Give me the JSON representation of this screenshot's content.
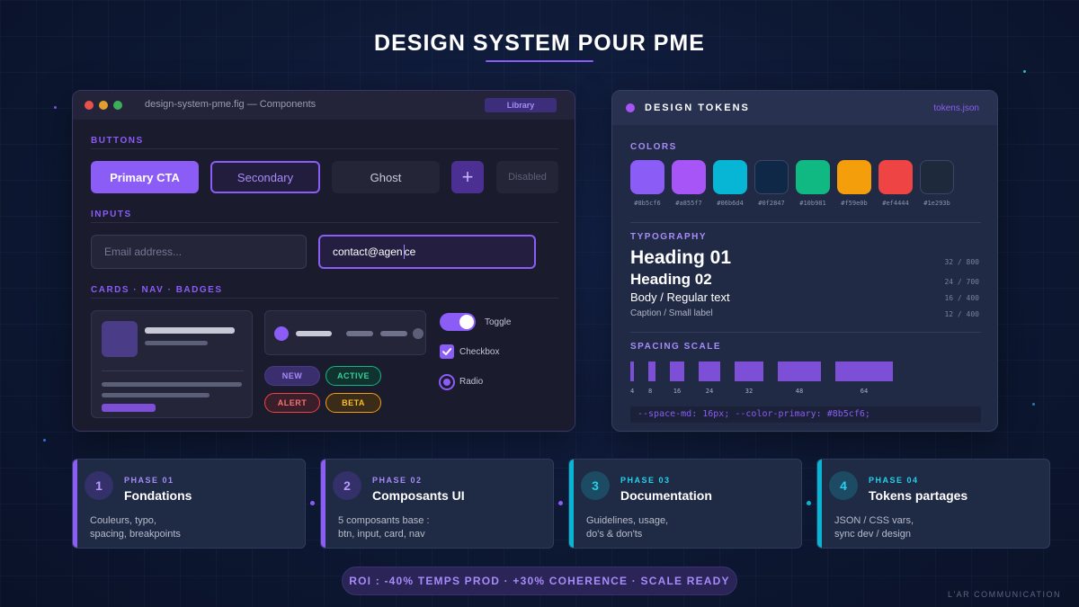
{
  "page": {
    "title": "DESIGN SYSTEM POUR PME",
    "roi": "ROI : -40% TEMPS PROD · +30% COHERENCE · SCALE READY",
    "footer": "L'AR COMMUNICATION"
  },
  "window": {
    "filename": "design-system-pme.fig — Components",
    "library_label": "Library",
    "sections": {
      "buttons": "BUTTONS",
      "inputs": "INPUTS",
      "cards": "CARDS · NAV · BADGES"
    },
    "buttons": {
      "primary": "Primary CTA",
      "secondary": "Secondary",
      "ghost": "Ghost",
      "icon": "+",
      "disabled": "Disabled"
    },
    "inputs": {
      "email_placeholder": "Email address...",
      "focused_before_caret": "contact@agen",
      "focused_after_caret": "ce"
    },
    "badges": [
      "NEW",
      "ACTIVE",
      "ALERT",
      "BETA"
    ],
    "controls": {
      "toggle": "Toggle",
      "toggle_on": true,
      "checkbox": "Checkbox",
      "checkbox_checked": true,
      "radio": "Radio",
      "radio_selected": true
    }
  },
  "tokens": {
    "title": "DESIGN TOKENS",
    "file": "tokens.json",
    "colors_label": "COLORS",
    "colors": [
      "#8b5cf6",
      "#a855f7",
      "#06b6d4",
      "#0f2847",
      "#10b981",
      "#f59e0b",
      "#ef4444",
      "#1e293b"
    ],
    "typography_label": "TYPOGRAPHY",
    "typography": [
      {
        "label": "Heading 01",
        "meta": "32 / 800"
      },
      {
        "label": "Heading 02",
        "meta": "24 / 700"
      },
      {
        "label": "Body / Regular text",
        "meta": "16 / 400"
      },
      {
        "label": "Caption / Small label",
        "meta": "12 / 400"
      }
    ],
    "spacing_label": "SPACING SCALE",
    "spacing": [
      "4",
      "8",
      "16",
      "24",
      "32",
      "48",
      "64"
    ],
    "code": "--space-md: 16px; --color-primary: #8b5cf6;"
  },
  "phases": [
    {
      "number": "1",
      "tag": "PHASE 01",
      "title": "Fondations",
      "desc": [
        "Couleurs, typo,",
        "spacing, breakpoints"
      ],
      "color": "#8b5cf6"
    },
    {
      "number": "2",
      "tag": "PHASE 02",
      "title": "Composants UI",
      "desc": [
        "5 composants base :",
        "btn, input, card, nav"
      ],
      "color": "#8b5cf6"
    },
    {
      "number": "3",
      "tag": "PHASE 03",
      "title": "Documentation",
      "desc": [
        "Guidelines, usage,",
        "do's & don'ts"
      ],
      "color": "#06b6d4"
    },
    {
      "number": "4",
      "tag": "PHASE 04",
      "title": "Tokens partages",
      "desc": [
        "JSON / CSS vars,",
        "sync dev / design"
      ],
      "color": "#06b6d4"
    }
  ]
}
